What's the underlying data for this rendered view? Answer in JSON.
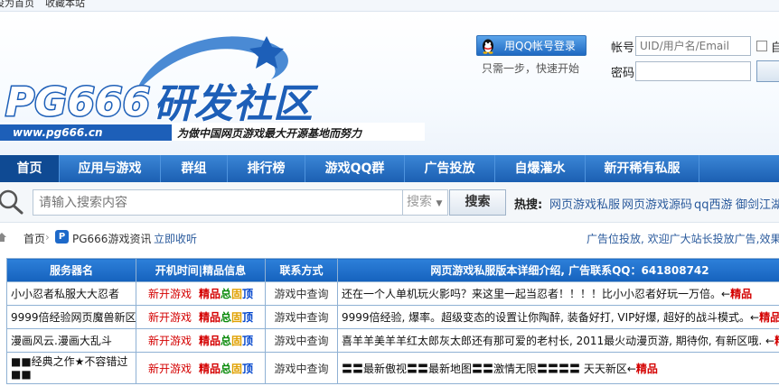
{
  "topbar": {
    "set_home": "设为首页",
    "bookmark": "收藏本站"
  },
  "logo": {
    "brand": "PG666",
    "title": "研发社区",
    "url": "www.pg666.cn",
    "slogan": "为做中国网页游戏最大开源基地而努力"
  },
  "login": {
    "qq_button": "用QQ帐号登录",
    "qq_tip": "只需一步，快速开始",
    "account_label": "帐号",
    "account_placeholder": "UID/用户名/Email",
    "password_label": "密码",
    "auto_text": "自"
  },
  "nav": [
    {
      "label": "首页"
    },
    {
      "label": "应用与游戏"
    },
    {
      "label": "群组"
    },
    {
      "label": "排行榜"
    },
    {
      "label": "游戏QQ群"
    },
    {
      "label": "广告投放"
    },
    {
      "label": "自爆灌水"
    },
    {
      "label": "新开稀有私服"
    }
  ],
  "search": {
    "placeholder": "请输入搜索内容",
    "type": "搜索",
    "button": "搜索",
    "hot_label": "热搜:",
    "hot_links": [
      "网页游戏私服",
      "网页游戏源码",
      "qq西游",
      "御剑江湖"
    ]
  },
  "breadcrumb": {
    "home": "首页",
    "sep": "›",
    "site": "PG666游戏资讯",
    "collect": "立即收听"
  },
  "ad_notice": "广告位投放, 欢迎广大站长投放广告,效果",
  "table": {
    "headers": [
      "服务器名",
      "开机时间|精品信息",
      "联系方式",
      "网页游戏私服版本详细介绍, 广告联系QQ：641808742"
    ],
    "rows": [
      {
        "name": "小小忍者私服大大忍者",
        "status": "新开游戏",
        "q": [
          "精",
          "品",
          "总",
          "固",
          "顶"
        ],
        "contact": "游戏中查询",
        "desc": "还在一个人单机玩火影吗？来这里一起当忍者！！！！比小小忍者好玩一万倍。←",
        "tag": "精品"
      },
      {
        "name": "9999倍经验网页魔兽新区",
        "status": "新开游戏",
        "q": [
          "精",
          "品",
          "总",
          "固",
          "顶"
        ],
        "contact": "游戏中查询",
        "desc": "9999倍经验, 爆率。超级变态的设置让你陶醉, 装备好打, VIP好爆, 超好的战斗模式。←",
        "tag": "精品"
      },
      {
        "name": "漫画风云.漫画大乱斗",
        "status": "新开游戏",
        "q": [
          "精",
          "品",
          "总",
          "固",
          "顶"
        ],
        "contact": "游戏中查询",
        "desc": "喜羊羊美羊羊红太郎灰太郎还有那可爱的老村长, 2011最火动漫页游, 期待你, 有新区哦. ←",
        "tag": "精品"
      },
      {
        "name": "■■经典之作★不容错过■■",
        "status": "新开游戏",
        "q": [
          "精",
          "品",
          "总",
          "固",
          "顶"
        ],
        "contact": "游戏中查询",
        "desc": "〓〓最新傲视〓〓最新地图〓〓激情无限〓〓〓〓 天天新区←",
        "tag": "精品"
      }
    ]
  },
  "colors": {
    "nav_bg": "#1b5fb2",
    "table_header": "#1562bd",
    "accent_red": "#d40000",
    "logo_blue": "#1d5fb8"
  }
}
